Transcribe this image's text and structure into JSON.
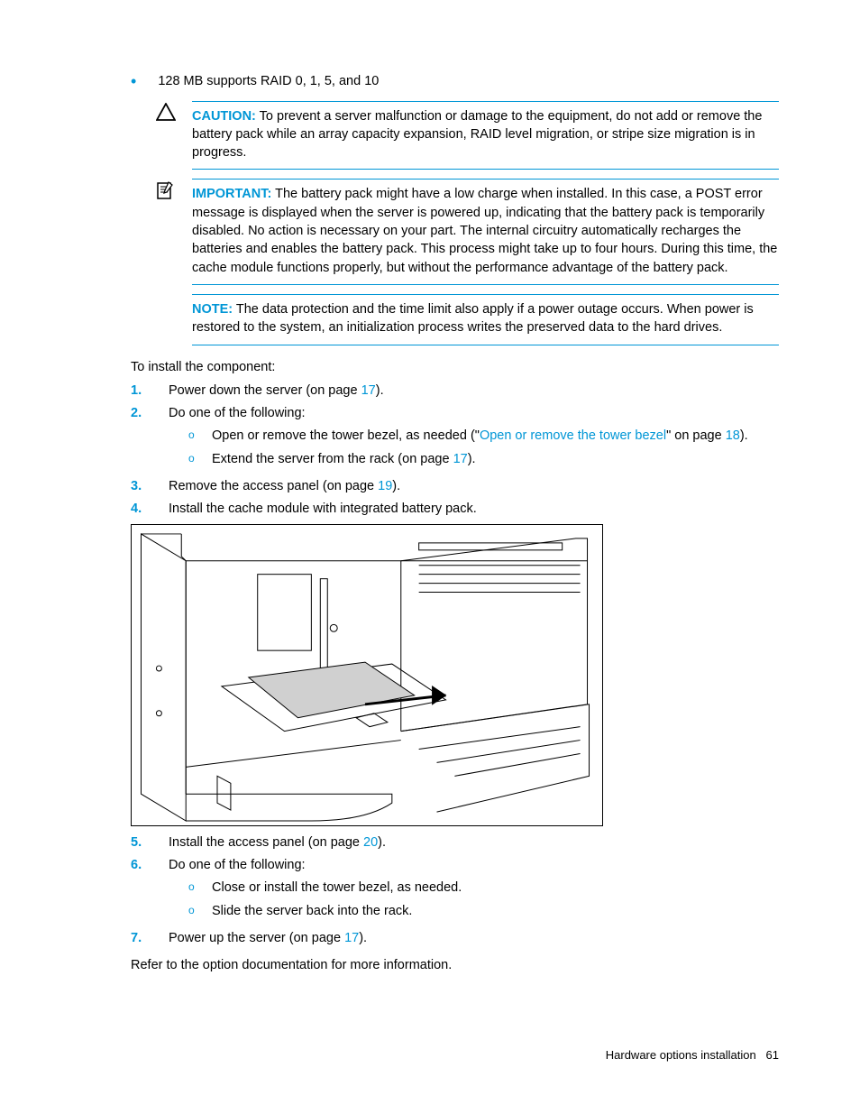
{
  "bullet_text": "128 MB supports RAID 0, 1, 5, and 10",
  "caution": {
    "label": "CAUTION:",
    "text": "To prevent a server malfunction or damage to the equipment, do not add or remove the battery pack while an array capacity expansion, RAID level migration, or stripe size migration is in progress."
  },
  "important": {
    "label": "IMPORTANT:",
    "text": "The battery pack might have a low charge when installed. In this case, a POST error message is displayed when the server is powered up, indicating that the battery pack is temporarily disabled. No action is necessary on your part. The internal circuitry automatically recharges the batteries and enables the battery pack. This process might take up to four hours. During this time, the cache module functions properly, but without the performance advantage of the battery pack."
  },
  "note": {
    "label": "NOTE:",
    "text": "The data protection and the time limit also apply if a power outage occurs. When power is restored to the system, an initialization process writes the preserved data to the hard drives."
  },
  "intro": "To install the component:",
  "steps": {
    "s1": {
      "num": "1.",
      "pre": "Power down the server (on page ",
      "link": "17",
      "post": ")."
    },
    "s2": {
      "num": "2.",
      "text": "Do one of the following:",
      "sub1_pre": "Open or remove the tower bezel, as needed (\"",
      "sub1_linktext": "Open or remove the tower bezel",
      "sub1_mid": "\" on page ",
      "sub1_link": "18",
      "sub1_post": ").",
      "sub2_pre": "Extend the server from the rack (on page ",
      "sub2_link": "17",
      "sub2_post": ")."
    },
    "s3": {
      "num": "3.",
      "pre": "Remove the access panel (on page ",
      "link": "19",
      "post": ")."
    },
    "s4": {
      "num": "4.",
      "text": "Install the cache module with integrated battery pack."
    },
    "s5": {
      "num": "5.",
      "pre": "Install the access panel (on page ",
      "link": "20",
      "post": ")."
    },
    "s6": {
      "num": "6.",
      "text": "Do one of the following:",
      "sub1": "Close or install the tower bezel, as needed.",
      "sub2": "Slide the server back into the rack."
    },
    "s7": {
      "num": "7.",
      "pre": "Power up the server (on page ",
      "link": "17",
      "post": ")."
    }
  },
  "closing": "Refer to the option documentation for more information.",
  "footer": {
    "section": "Hardware options installation",
    "page": "61"
  },
  "sub_marker": "o"
}
